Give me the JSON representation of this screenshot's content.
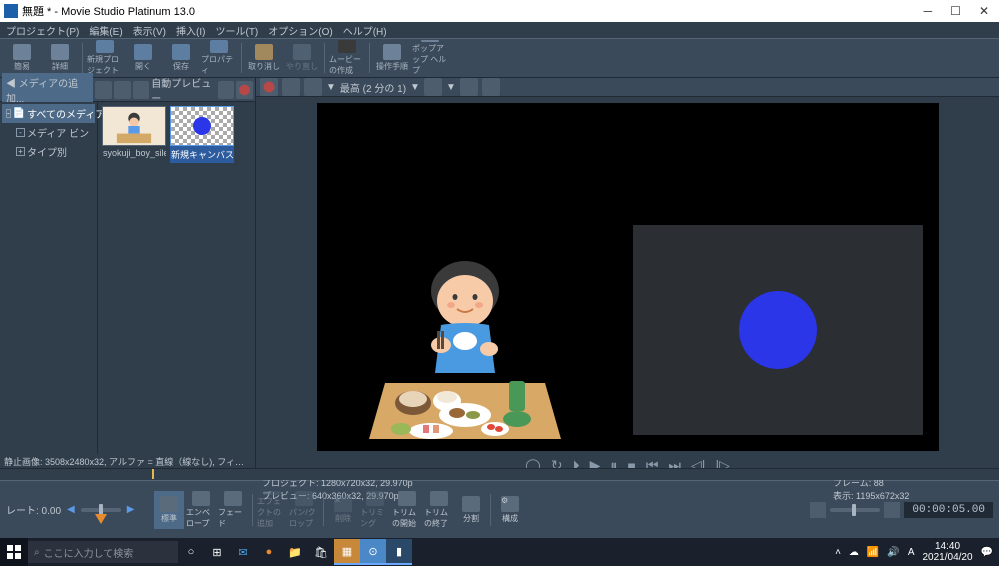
{
  "title": "無題 * - Movie Studio Platinum 13.0",
  "menu": [
    "プロジェクト(P)",
    "編集(E)",
    "表示(V)",
    "挿入(I)",
    "ツール(T)",
    "オプション(O)",
    "ヘルプ(H)"
  ],
  "toolbar": [
    {
      "label": "簡易"
    },
    {
      "label": "詳細"
    },
    {
      "sep": true
    },
    {
      "label": "新規プロジェクト"
    },
    {
      "label": "開く"
    },
    {
      "label": "保存"
    },
    {
      "label": "プロパティ"
    },
    {
      "sep": true
    },
    {
      "label": "取り消し"
    },
    {
      "label": "やり直し"
    },
    {
      "sep": true
    },
    {
      "label": "ムービーの作成"
    },
    {
      "sep": true
    },
    {
      "label": "操作手順"
    },
    {
      "label": "ポップアップ ヘルプ"
    }
  ],
  "media_tab": "メディアの追加...",
  "auto_preview": "自動プレビュー",
  "tree": [
    {
      "label": "すべてのメディア",
      "sel": true,
      "exp": "-"
    },
    {
      "label": "メディア ビン",
      "sel": false,
      "exp": "-"
    },
    {
      "label": "タイプ別",
      "sel": false,
      "exp": "+"
    }
  ],
  "thumbs": [
    {
      "label": "syokuji_boy_silent.png",
      "sel": false,
      "type": "boy"
    },
    {
      "label": "新規キャンバス.png",
      "sel": true,
      "type": "circle"
    }
  ],
  "media_status": "静止画像: 3508x2480x32, アルファ = 直線（線なし), フィ…",
  "preview_quality": "最高 (2 分の 1)",
  "project_info": {
    "l1": "プロジェクト:",
    "v1": "1280x720x32, 29.970p",
    "l2": "プレビュー:",
    "v2": "640x360x32, 29.970p"
  },
  "frame_info": {
    "l1": "フレーム:",
    "v1": "88",
    "l2": "表示:",
    "v2": "1195x672x32"
  },
  "rate_label": "レート: 0.00",
  "tl_tools": [
    {
      "label": "標準"
    },
    {
      "label": "エンベロープ"
    },
    {
      "label": "フェード"
    },
    {
      "sep": true
    },
    {
      "label": "エフェクトの追加",
      "dis": true
    },
    {
      "label": "パン/クロップ",
      "dis": true
    },
    {
      "sep": true
    },
    {
      "label": "削除",
      "dis": true
    },
    {
      "label": "トリミング",
      "dis": true
    },
    {
      "label": "トリムの開始"
    },
    {
      "label": "トリムの終了"
    },
    {
      "label": "分割"
    },
    {
      "sep": true
    },
    {
      "label": "構成"
    }
  ],
  "timecode": "00:00:05.00",
  "search_placeholder": "ここに入力して検索",
  "clock": {
    "time": "14:40",
    "date": "2021/04/20"
  }
}
